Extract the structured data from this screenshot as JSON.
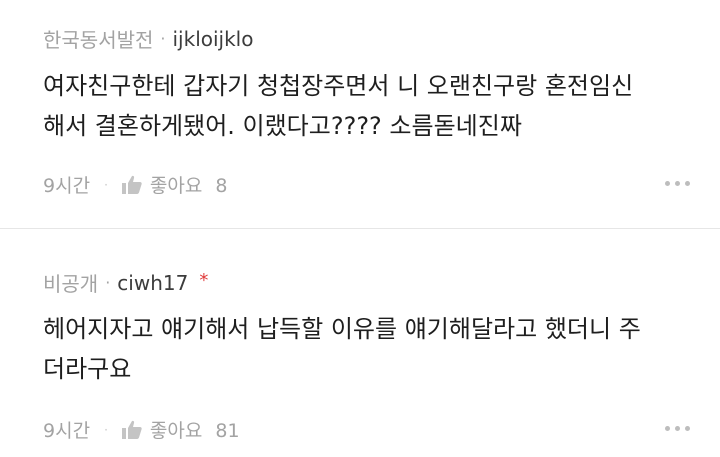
{
  "comments": [
    {
      "org": "한국동서발전",
      "separator": "·",
      "username": "ijkloijklo",
      "text_line1": "여자친구한테 갑자기 청첩장주면서 니 오랜친구랑 혼전임신",
      "text_line2": "해서 결혼하게됐어.  이랬다고????  소름돋네진짜",
      "time": "9시간",
      "action_dot": "·",
      "like_label": "좋아요",
      "like_count": "8",
      "thumb_icon": "thumbs-up-icon",
      "more_icon": "more-dots-icon"
    },
    {
      "org": "비공개",
      "separator": "·",
      "username": "ciwh17",
      "badge": "*",
      "text_line1": "헤어지자고 얘기해서 납득할 이유를 얘기해달라고 했더니 주",
      "text_line2": "더라구요",
      "time": "9시간",
      "action_dot": "·",
      "like_label": "좋아요",
      "like_count": "81",
      "thumb_icon": "thumbs-up-icon",
      "more_icon": "more-dots-icon"
    }
  ],
  "colors": {
    "muted": "#a3a3a3",
    "username": "#3c3c3c",
    "body": "#1e1e1e",
    "badge": "#e03b3b",
    "divider": "#e6e6e6"
  }
}
